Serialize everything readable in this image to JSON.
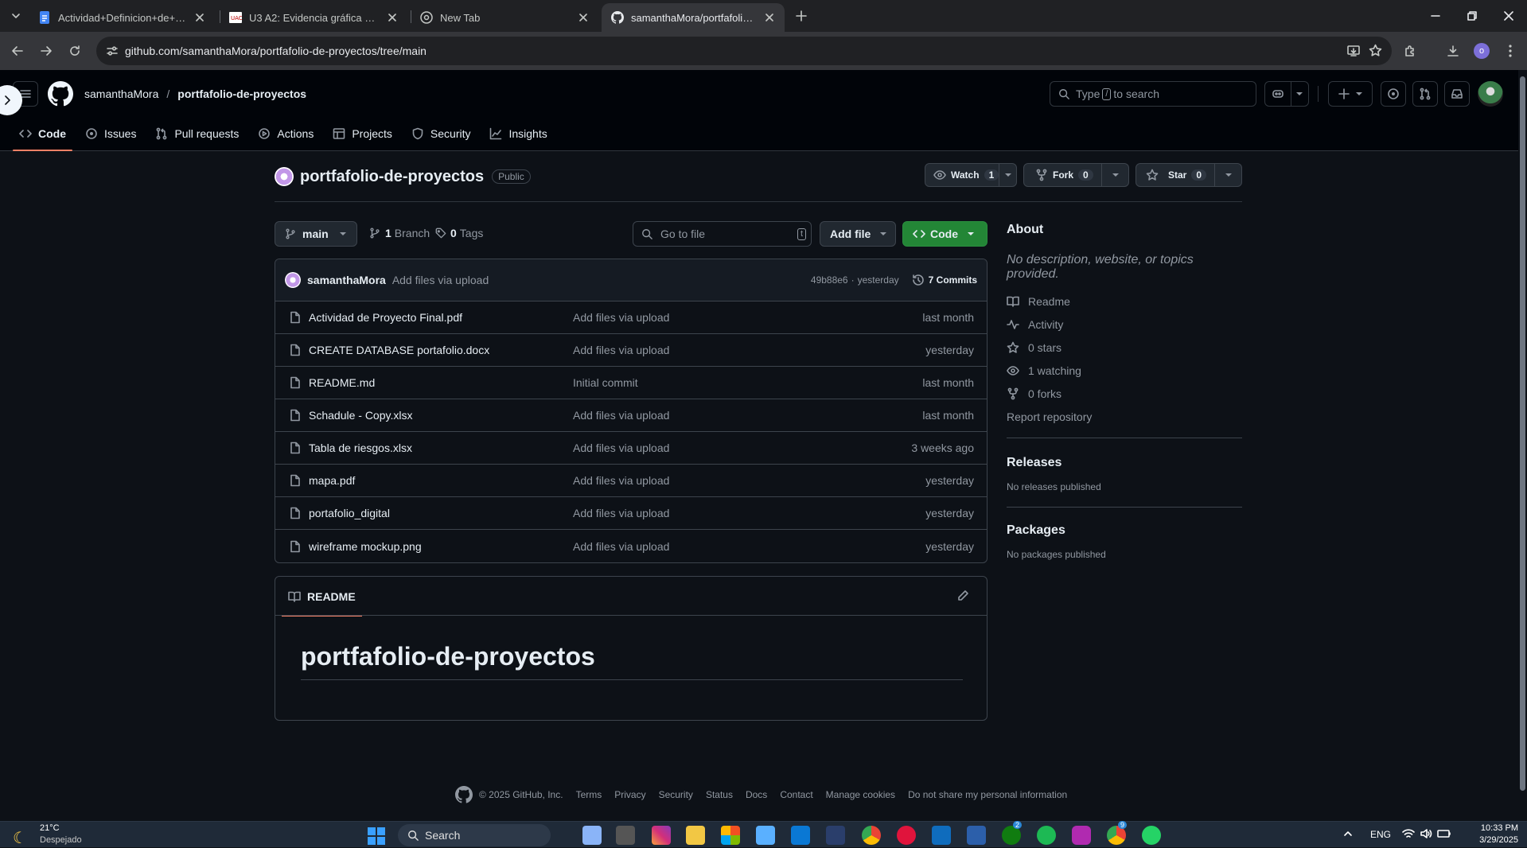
{
  "browser": {
    "tabs": [
      {
        "title": "Actividad+Definicion+de+Probl",
        "active": false
      },
      {
        "title": "U3 A2: Evidencia gráfica de ma",
        "active": false
      },
      {
        "title": "New Tab",
        "active": false
      },
      {
        "title": "samanthaMora/portfafolio-de-p",
        "active": true
      }
    ],
    "url": "github.com/samanthaMora/portfafolio-de-proyectos/tree/main",
    "profile_initial": "o"
  },
  "github": {
    "owner": "samanthaMora",
    "breadcrumb_sep": "/",
    "repo": "portfafolio-de-proyectos",
    "search_prefix": "Type",
    "search_key": "/",
    "search_suffix": "to search",
    "nav": [
      {
        "label": "Code",
        "icon": "code-icon",
        "selected": true
      },
      {
        "label": "Issues",
        "icon": "issue-icon"
      },
      {
        "label": "Pull requests",
        "icon": "pull-request-icon"
      },
      {
        "label": "Actions",
        "icon": "play-icon"
      },
      {
        "label": "Projects",
        "icon": "table-icon"
      },
      {
        "label": "Security",
        "icon": "shield-icon"
      },
      {
        "label": "Insights",
        "icon": "graph-icon"
      }
    ],
    "visibility": "Public",
    "watch": {
      "label": "Watch",
      "count": "1"
    },
    "fork": {
      "label": "Fork",
      "count": "0"
    },
    "star": {
      "label": "Star",
      "count": "0"
    },
    "branch": "main",
    "branch_count": "1",
    "branch_label": "Branch",
    "tag_count": "0",
    "tag_label": "Tags",
    "goto_placeholder": "Go to file",
    "goto_key": "t",
    "add_file": "Add file",
    "code_btn": "Code",
    "latest_commit": {
      "author": "samanthaMora",
      "message": "Add files via upload",
      "sha": "49b88e6",
      "dot": "·",
      "when": "yesterday",
      "commits": "7 Commits"
    },
    "files": [
      {
        "name": "Actividad de Proyecto Final.pdf",
        "message": "Add files via upload",
        "age": "last month"
      },
      {
        "name": "CREATE DATABASE portafolio.docx",
        "message": "Add files via upload",
        "age": "yesterday"
      },
      {
        "name": "README.md",
        "message": "Initial commit",
        "age": "last month"
      },
      {
        "name": "Schadule - Copy.xlsx",
        "message": "Add files via upload",
        "age": "last month"
      },
      {
        "name": "Tabla de riesgos.xlsx",
        "message": "Add files via upload",
        "age": "3 weeks ago"
      },
      {
        "name": "mapa.pdf",
        "message": "Add files via upload",
        "age": "yesterday"
      },
      {
        "name": "portafolio_digital",
        "message": "Add files via upload",
        "age": "yesterday"
      },
      {
        "name": "wireframe mockup.png",
        "message": "Add files via upload",
        "age": "yesterday"
      }
    ],
    "readme_tab": "README",
    "readme_heading": "portfafolio-de-proyectos",
    "about": {
      "title": "About",
      "description": "No description, website, or topics provided.",
      "items": [
        {
          "label": "Readme",
          "icon": "book-icon"
        },
        {
          "label": "Activity",
          "icon": "pulse-icon"
        },
        {
          "label": "0 stars",
          "icon": "star-icon"
        },
        {
          "label": "1 watching",
          "icon": "eye-icon"
        },
        {
          "label": "0 forks",
          "icon": "fork-icon"
        }
      ],
      "report": "Report repository",
      "releases_title": "Releases",
      "releases_text": "No releases published",
      "packages_title": "Packages",
      "packages_text": "No packages published"
    },
    "footer": [
      "© 2025 GitHub, Inc.",
      "Terms",
      "Privacy",
      "Security",
      "Status",
      "Docs",
      "Contact",
      "Manage cookies",
      "Do not share my personal information"
    ]
  },
  "taskbar": {
    "weather_temp": "21°C",
    "weather_desc": "Despejado",
    "search": "Search",
    "lang": "ENG",
    "time": "10:33 PM",
    "date": "3/29/2025",
    "badge_chat": "2",
    "badge_chrome": "9"
  },
  "colors": {
    "accent_green": "#238636",
    "nav_underline": "#f78166",
    "bg": "#0d1117"
  }
}
